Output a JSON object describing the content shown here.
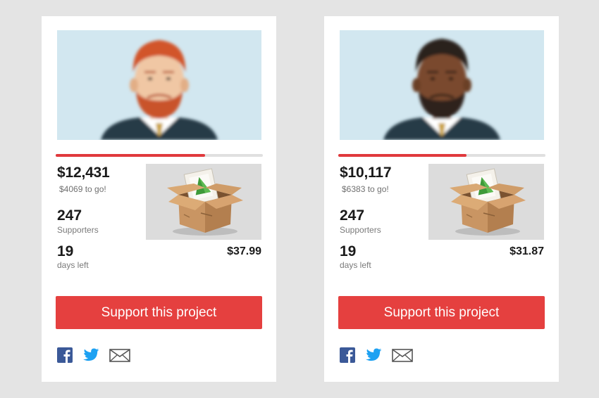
{
  "cards": [
    {
      "amount": "$12,431",
      "to_go": "$4069 to go!",
      "supporters_count": "247",
      "supporters_label": "Supporters",
      "days_count": "19",
      "days_label": "days left",
      "reward_price": "$37.99",
      "button_label": "Support this project",
      "progress_fraction": 0.72,
      "avatar": {
        "hair_color": "#d2552a",
        "skin_color": "#f0c7a4",
        "beard_color": "#c9532a"
      }
    },
    {
      "amount": "$10,117",
      "to_go": "$6383 to go!",
      "supporters_count": "247",
      "supporters_label": "Supporters",
      "days_count": "19",
      "days_label": "days left",
      "reward_price": "$31.87",
      "button_label": "Support this project",
      "progress_fraction": 0.62,
      "avatar": {
        "hair_color": "#2a231c",
        "skin_color": "#7a4a2e",
        "beard_color": "#2e241b"
      }
    }
  ],
  "icons": [
    "facebook-icon",
    "twitter-icon",
    "mail-icon"
  ],
  "colors": {
    "accent": "#e5403f",
    "progress_track": "#e0e0e0",
    "avatar_bg": "#d2e7f0",
    "facebook": "#3b5998",
    "twitter": "#1da1f2"
  }
}
